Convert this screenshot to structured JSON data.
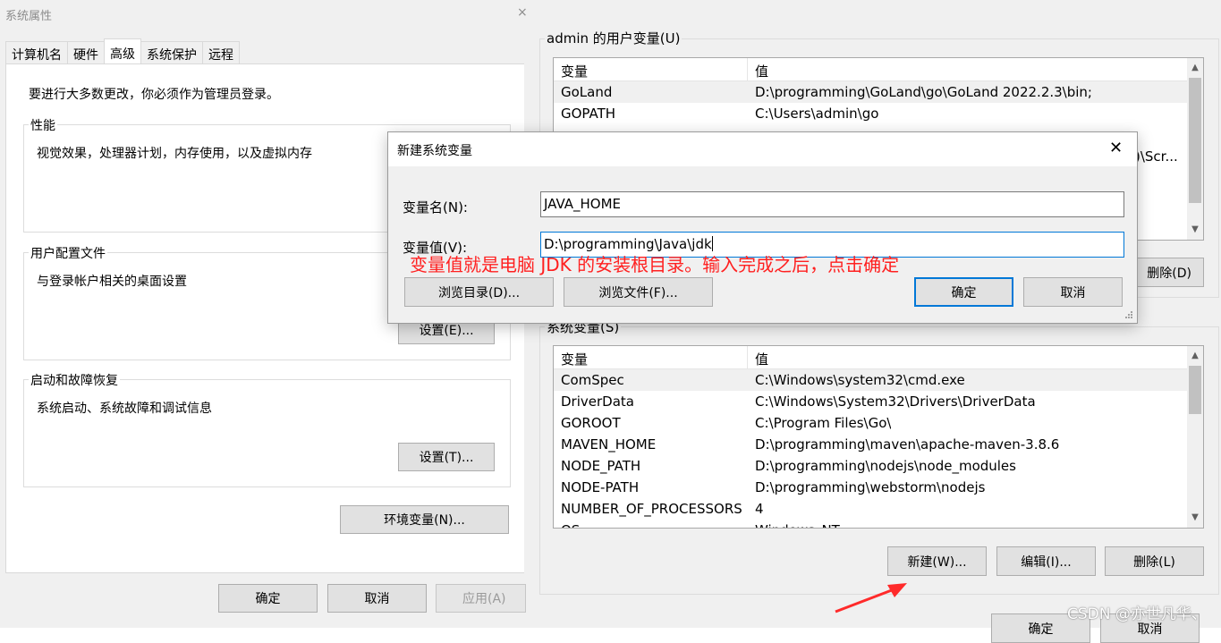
{
  "system_properties": {
    "title": "系统属性",
    "close_glyph": "×",
    "tabs": [
      "计算机名",
      "硬件",
      "高级",
      "系统保护",
      "远程"
    ],
    "active_tab": 2,
    "admin_notice": "要进行大多数更改，你必须作为管理员登录。",
    "groups": {
      "performance": {
        "title": "性能",
        "desc": "视觉效果，处理器计划，内存使用，以及虚拟内存"
      },
      "user_profiles": {
        "title": "用户配置文件",
        "desc": "与登录帐户相关的桌面设置",
        "button": "设置(E)..."
      },
      "startup_recovery": {
        "title": "启动和故障恢复",
        "desc": "系统启动、系统故障和调试信息",
        "button": "设置(T)..."
      }
    },
    "env_button": "环境变量(N)...",
    "ok_button": "确定",
    "cancel_button": "取消",
    "apply_button": "应用(A)"
  },
  "env_vars": {
    "user_section_title": "admin 的用户变量(U)",
    "columns": {
      "name": "变量",
      "value": "值"
    },
    "user_rows": [
      {
        "name": "GoLand",
        "value": "D:\\programming\\GoLand\\go\\GoLand 2022.2.3\\bin;"
      },
      {
        "name": "GOPATH",
        "value": "C:\\Users\\admin\\go"
      }
    ],
    "user_partial_value": ")\\Scr...",
    "user_delete_button": "删除(D)",
    "system_section_title": "系统变量(S)",
    "system_rows": [
      {
        "name": "ComSpec",
        "value": "C:\\Windows\\system32\\cmd.exe"
      },
      {
        "name": "DriverData",
        "value": "C:\\Windows\\System32\\Drivers\\DriverData"
      },
      {
        "name": "GOROOT",
        "value": "C:\\Program Files\\Go\\"
      },
      {
        "name": "MAVEN_HOME",
        "value": "D:\\programming\\maven\\apache-maven-3.8.6"
      },
      {
        "name": "NODE_PATH",
        "value": "D:\\programming\\nodejs\\node_modules"
      },
      {
        "name": "NODE-PATH",
        "value": "D:\\programming\\webstorm\\nodejs"
      },
      {
        "name": "NUMBER_OF_PROCESSORS",
        "value": "4"
      },
      {
        "name": "OS",
        "value": "Windows_NT"
      }
    ],
    "system_buttons": {
      "new": "新建(W)...",
      "edit": "编辑(I)...",
      "delete": "删除(L)"
    },
    "ok_button": "确定",
    "cancel_button": "取消"
  },
  "new_var_dialog": {
    "title": "新建系统变量",
    "close_glyph": "✕",
    "name_label": "变量名(N):",
    "name_value": "JAVA_HOME",
    "value_label": "变量值(V):",
    "value_value": "D:\\programming\\Java\\jdk",
    "browse_dir_button": "浏览目录(D)...",
    "browse_file_button": "浏览文件(F)...",
    "ok_button": "确定",
    "cancel_button": "取消"
  },
  "annotation_text": "变量值就是电脑 JDK 的安装根目录。输入完成之后，点击确定",
  "watermark": "CSDN @亦世凡华、",
  "colors": {
    "accent": "#0078d7",
    "annotation": "#ff2020",
    "arrow": "#ff2a2a"
  }
}
